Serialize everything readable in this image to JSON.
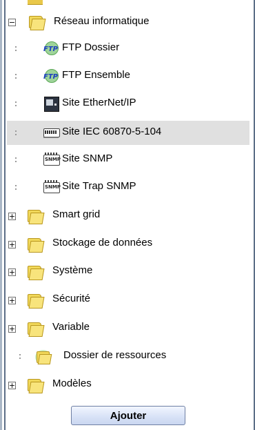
{
  "tree": {
    "network": {
      "label": "Réseau informatique",
      "expanded": true,
      "children": [
        {
          "label": "FTP Dossier",
          "icon": "ftp-icon"
        },
        {
          "label": "FTP Ensemble",
          "icon": "ftp-icon"
        },
        {
          "label": "Site EtherNet/IP",
          "icon": "ethernet-ip-device-icon"
        },
        {
          "label": "Site IEC 60870-5-104",
          "icon": "iec-device-icon",
          "selected": true
        },
        {
          "label": "Site SNMP",
          "icon": "snmp-icon"
        },
        {
          "label": "Site Trap SNMP",
          "icon": "snmp-icon"
        }
      ]
    },
    "folders": [
      {
        "label": "Smart grid"
      },
      {
        "label": "Stockage de données"
      },
      {
        "label": "Système"
      },
      {
        "label": "Sécurité"
      },
      {
        "label": "Variable"
      }
    ],
    "resources": {
      "label": "Dossier de ressources"
    },
    "models": {
      "label": "Modèles"
    }
  },
  "toggle_symbols": {
    "expanded": "−",
    "collapsed": "+"
  },
  "add_button": {
    "label": "Ajouter"
  },
  "colors": {
    "selected_row": "#e0e0e0",
    "button_border": "#6d7ea3",
    "folder": "#f1d85a"
  }
}
